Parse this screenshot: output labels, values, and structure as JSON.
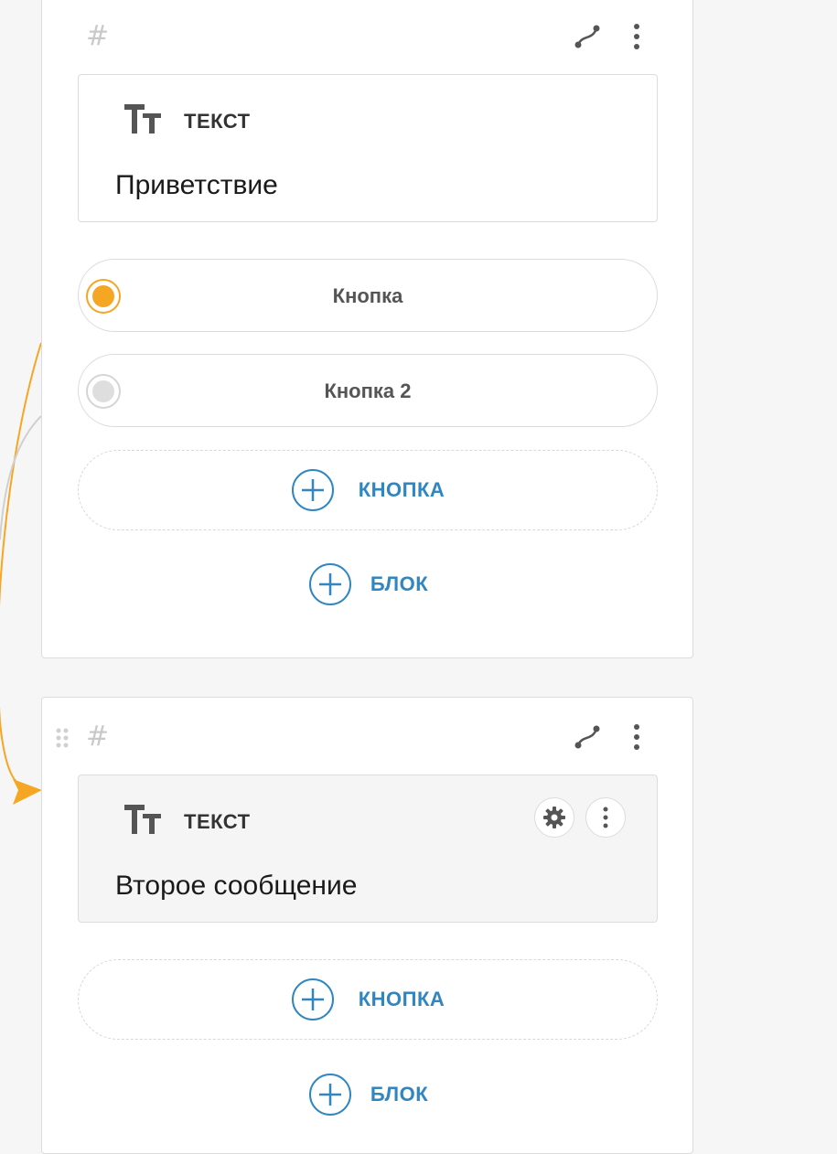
{
  "colors": {
    "accent_orange": "#f5a623",
    "accent_blue": "#2f86c0",
    "border": "#dcdcdc",
    "background": "#f6f6f6"
  },
  "blocks": [
    {
      "id_symbol": "#",
      "icons": [
        "route-icon",
        "more-vertical-icon"
      ],
      "message": {
        "type_label": "ТЕКСТ",
        "text": "Приветствие"
      },
      "buttons": [
        {
          "label": "Кнопка",
          "connected": true
        },
        {
          "label": "Кнопка 2",
          "connected": false
        }
      ],
      "add_button_label": "КНОПКА",
      "add_block_label": "БЛОК"
    },
    {
      "id_symbol": "#",
      "icons": [
        "drag-handle-icon",
        "route-icon",
        "more-vertical-icon"
      ],
      "message": {
        "type_label": "ТЕКСТ",
        "text": "Второе сообщение",
        "icons": [
          "gear-icon",
          "more-vertical-icon"
        ]
      },
      "add_button_label": "КНОПКА",
      "add_block_label": "БЛОК"
    }
  ]
}
